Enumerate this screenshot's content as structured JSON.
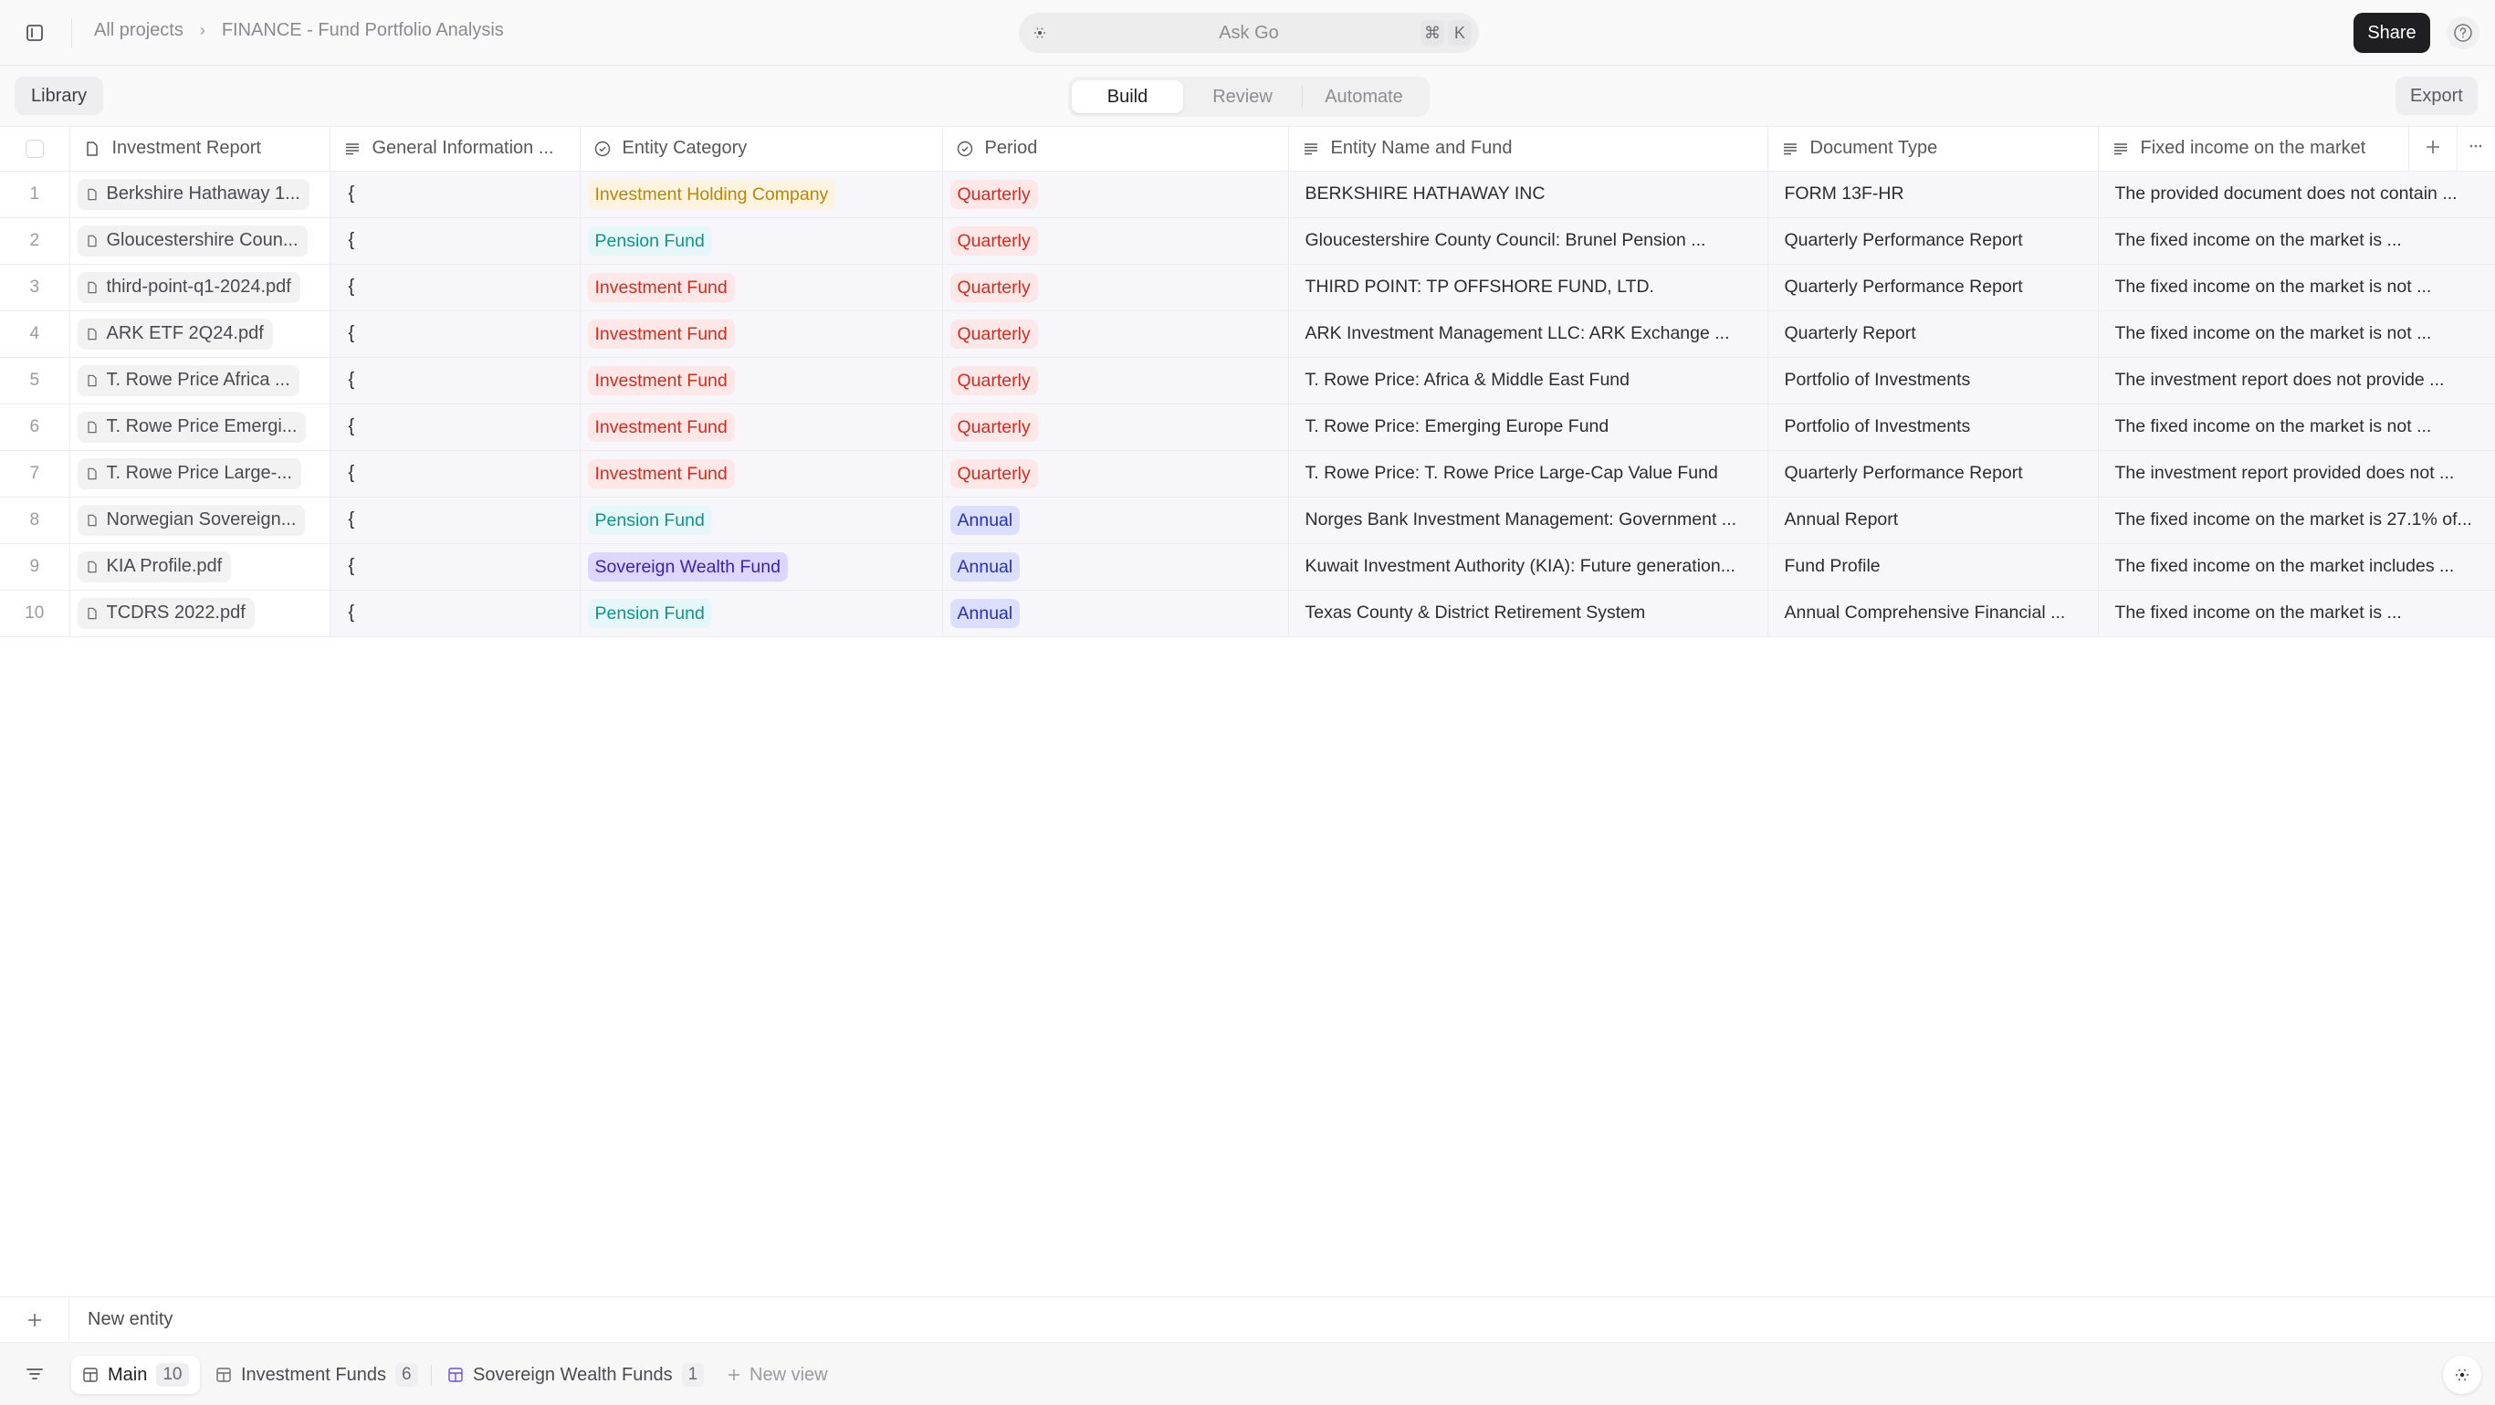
{
  "topbar": {
    "breadcrumb": [
      "All projects",
      "FINANCE - Fund Portfolio Analysis"
    ],
    "breadcrumb_separator": "›",
    "ask_placeholder": "Ask Go",
    "shortcut_keys": [
      "⌘",
      "K"
    ],
    "share_label": "Share",
    "help_icon": "question-circle-icon"
  },
  "subbar": {
    "library_label": "Library",
    "mode_tabs": [
      {
        "label": "Build",
        "active": true
      },
      {
        "label": "Review",
        "active": false
      },
      {
        "label": "Automate",
        "active": false
      }
    ],
    "export_label": "Export"
  },
  "table": {
    "columns": [
      {
        "label": "Investment Report",
        "icon": "file-icon"
      },
      {
        "label": "General Information ...",
        "icon": "text-lines-icon"
      },
      {
        "label": "Entity Category",
        "icon": "check-circle-icon"
      },
      {
        "label": "Period",
        "icon": "check-circle-icon"
      },
      {
        "label": "Entity Name and Fund",
        "icon": "text-lines-icon"
      },
      {
        "label": "Document Type",
        "icon": "text-lines-icon"
      },
      {
        "label": "Fixed income on the market",
        "icon": "text-lines-icon"
      }
    ],
    "add_column_icon": "plus-icon",
    "more_icon": "ellipsis-icon",
    "tag_colors": {
      "Investment Holding Company": {
        "bg": "#fdf3e1",
        "fg": "#b8860b"
      },
      "Pension Fund": {
        "bg": "#e6f7f9",
        "fg": "#12938a"
      },
      "Investment Fund": {
        "bg": "#fde7e7",
        "fg": "#d12c1f"
      },
      "Sovereign Wealth Fund": {
        "bg": "#ddd6fe",
        "fg": "#3b1fb8"
      },
      "Quarterly": {
        "bg": "#fde7e7",
        "fg": "#d12c1f"
      },
      "Annual": {
        "bg": "#dcdefd",
        "fg": "#2730b8"
      }
    },
    "rows": [
      {
        "num": "1",
        "report": "Berkshire Hathaway 1...",
        "general": "{",
        "category": "Investment Holding Company",
        "period": "Quarterly",
        "entity": "BERKSHIRE HATHAWAY INC",
        "doctype": "FORM 13F-HR",
        "fixed_income": "The provided document does not contain ..."
      },
      {
        "num": "2",
        "report": "Gloucestershire Coun...",
        "general": "{",
        "category": "Pension Fund",
        "period": "Quarterly",
        "entity": "Gloucestershire County Council: Brunel Pension ...",
        "doctype": "Quarterly Performance Report",
        "fixed_income": "The fixed income on the market is ..."
      },
      {
        "num": "3",
        "report": "third-point-q1-2024.pdf",
        "general": "{",
        "category": "Investment Fund",
        "period": "Quarterly",
        "entity": "THIRD POINT: TP OFFSHORE FUND, LTD.",
        "doctype": "Quarterly Performance Report",
        "fixed_income": "The fixed income on the market is not ..."
      },
      {
        "num": "4",
        "report": "ARK ETF 2Q24.pdf",
        "general": "{",
        "category": "Investment Fund",
        "period": "Quarterly",
        "entity": "ARK Investment Management LLC: ARK Exchange ...",
        "doctype": "Quarterly Report",
        "fixed_income": "The fixed income on the market is not ..."
      },
      {
        "num": "5",
        "report": "T. Rowe Price Africa ...",
        "general": "{",
        "category": "Investment Fund",
        "period": "Quarterly",
        "entity": "T. Rowe Price: Africa & Middle East Fund",
        "doctype": "Portfolio of Investments",
        "fixed_income": "The investment report does not provide ..."
      },
      {
        "num": "6",
        "report": "T. Rowe Price Emergi...",
        "general": "{",
        "category": "Investment Fund",
        "period": "Quarterly",
        "entity": "T. Rowe Price: Emerging Europe Fund",
        "doctype": "Portfolio of Investments",
        "fixed_income": "The fixed income on the market is not ..."
      },
      {
        "num": "7",
        "report": "T. Rowe Price Large-...",
        "general": "{",
        "category": "Investment Fund",
        "period": "Quarterly",
        "entity": "T. Rowe Price: T. Rowe Price Large-Cap Value Fund",
        "doctype": "Quarterly Performance Report",
        "fixed_income": "The investment report provided does not ..."
      },
      {
        "num": "8",
        "report": "Norwegian Sovereign...",
        "general": "{",
        "category": "Pension Fund",
        "period": "Annual",
        "entity": "Norges Bank Investment Management: Government ...",
        "doctype": "Annual Report",
        "fixed_income": "The fixed income on the market is 27.1% of..."
      },
      {
        "num": "9",
        "report": "KIA Profile.pdf",
        "general": "{",
        "category": "Sovereign Wealth Fund",
        "period": "Annual",
        "entity": "Kuwait Investment Authority (KIA): Future generation...",
        "doctype": "Fund Profile",
        "fixed_income": "The fixed income on the market includes ..."
      },
      {
        "num": "10",
        "report": "TCDRS 2022.pdf",
        "general": "{",
        "category": "Pension Fund",
        "period": "Annual",
        "entity": "Texas County & District Retirement System",
        "doctype": "Annual Comprehensive Financial ...",
        "fixed_income": "The fixed income on the market is ..."
      }
    ],
    "new_entity_label": "New entity"
  },
  "bottombar": {
    "views": [
      {
        "label": "Main",
        "count": "10",
        "active": true
      },
      {
        "label": "Investment Funds",
        "count": "6",
        "active": false
      },
      {
        "label": "Sovereign Wealth Funds",
        "count": "1",
        "active": false
      }
    ],
    "new_view_label": "New view"
  }
}
